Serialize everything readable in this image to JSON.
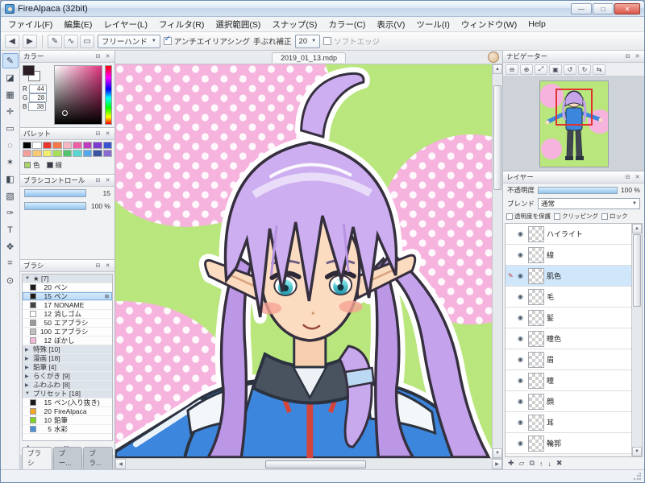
{
  "window": {
    "title": "FireAlpaca (32bit)"
  },
  "window_controls": {
    "minimize": "—",
    "maximize": "□",
    "close": "✕"
  },
  "menu": {
    "items": [
      "ファイル(F)",
      "編集(E)",
      "レイヤー(L)",
      "フィルタ(R)",
      "選択範囲(S)",
      "スナップ(S)",
      "カラー(C)",
      "表示(V)",
      "ツール(I)",
      "ウィンドウ(W)",
      "Help"
    ]
  },
  "toolbar": {
    "back": "◀",
    "forward": "▶",
    "mode_icons": [
      {
        "name": "freehand-stroke-icon",
        "glyph": "✎"
      },
      {
        "name": "curve-stroke-icon",
        "glyph": "∿"
      },
      {
        "name": "rect-stroke-icon",
        "glyph": "▭"
      }
    ],
    "stroke_select": "フリーハンド",
    "antialias_label": "アンチエイリアシング",
    "stabilizer_label": "手ぶれ補正",
    "stabilizer_value": "20",
    "softedge_label": "ソフトエッジ"
  },
  "tools": [
    {
      "name": "brush-tool",
      "glyph": "✎",
      "selected": true
    },
    {
      "name": "eraser-tool",
      "glyph": "◪"
    },
    {
      "name": "dot-tool",
      "glyph": "▦"
    },
    {
      "name": "move-tool",
      "glyph": "✛"
    },
    {
      "name": "select-rect-tool",
      "glyph": "▭"
    },
    {
      "name": "lasso-tool",
      "glyph": "◌"
    },
    {
      "name": "magic-wand-tool",
      "glyph": "✶"
    },
    {
      "name": "bucket-tool",
      "glyph": "◧"
    },
    {
      "name": "gradient-tool",
      "glyph": "▧"
    },
    {
      "name": "eyedropper-tool",
      "glyph": "✑"
    },
    {
      "name": "text-tool",
      "glyph": "T"
    },
    {
      "name": "hand-tool",
      "glyph": "✥"
    },
    {
      "name": "divide-tool",
      "glyph": "⌗"
    },
    {
      "name": "snap-tool",
      "glyph": "⊙"
    }
  ],
  "color_panel": {
    "title": "カラー",
    "channels": [
      {
        "label": "R",
        "value": "44"
      },
      {
        "label": "G",
        "value": "28"
      },
      {
        "label": "B",
        "value": "38"
      }
    ]
  },
  "palette_panel": {
    "title": "パレット",
    "swatches": [
      "#000000",
      "#ffffff",
      "#e8352e",
      "#f2784b",
      "#f7b6c2",
      "#ee5fa7",
      "#c13bbf",
      "#7e3bd0",
      "#3b55d0",
      "#f4a09a",
      "#f7c873",
      "#f3ef6d",
      "#a6e05a",
      "#4fc46a",
      "#58d7d2",
      "#55a7ec",
      "#3b55a0",
      "#8a6ad0"
    ],
    "items": [
      {
        "label": "色",
        "chip": "#a6d36a"
      },
      {
        "label": "線",
        "chip": "#3a3a4a"
      }
    ]
  },
  "brush_control_panel": {
    "title": "ブラシコントロール",
    "size_value": "15",
    "opacity_value": "100 %"
  },
  "brush_panel": {
    "title": "ブラシ",
    "rows": [
      {
        "type": "group",
        "arrow": "▼",
        "label": "★ [7]"
      },
      {
        "size": "20",
        "label": "ペン",
        "swatch": "#1a1a1a"
      },
      {
        "size": "15",
        "label": "ペン",
        "swatch": "#1a1a1a",
        "selected": true
      },
      {
        "size": "17",
        "label": "NONAME",
        "swatch": "#444444"
      },
      {
        "size": "12",
        "label": "消しゴム",
        "swatch": "#ffffff"
      },
      {
        "size": "50",
        "label": "エアブラシ",
        "swatch": "#9a9a9a"
      },
      {
        "size": "100",
        "label": "エアブラシ",
        "swatch": "#c0c0c0"
      },
      {
        "size": "12",
        "label": "ぼかし",
        "swatch": "#f2b8d8"
      },
      {
        "type": "group",
        "arrow": "▶",
        "label": "特殊 [10]"
      },
      {
        "type": "group",
        "arrow": "▶",
        "label": "漫画 [18]"
      },
      {
        "type": "group",
        "arrow": "▶",
        "label": "鉛筆 [4]"
      },
      {
        "type": "group",
        "arrow": "▶",
        "label": "らくがき [9]"
      },
      {
        "type": "group",
        "arrow": "▶",
        "label": "ふわふわ [8]"
      },
      {
        "type": "group",
        "arrow": "▼",
        "label": "プリセット [18]"
      },
      {
        "size": "15",
        "label": "ペン(入り抜き)",
        "swatch": "#1a1a1a"
      },
      {
        "size": "20",
        "label": "FireAlpaca",
        "swatch": "#f5a623"
      },
      {
        "size": "10",
        "label": "鉛筆",
        "swatch": "#7ed321"
      },
      {
        "size": "5",
        "label": "水彩",
        "swatch": "#4a90d9"
      }
    ],
    "footer_icons": [
      {
        "name": "add-brush-icon",
        "glyph": "✚"
      },
      {
        "name": "brush-folder-icon",
        "glyph": "▱"
      },
      {
        "name": "brush-up-icon",
        "glyph": "↑"
      },
      {
        "name": "brush-down-icon",
        "glyph": "↓"
      },
      {
        "name": "delete-brush-icon",
        "glyph": "✖"
      }
    ]
  },
  "dock_tabs": [
    {
      "label": "ブラシ",
      "active": true
    },
    {
      "label": "ブー..."
    },
    {
      "label": "ブラ..."
    }
  ],
  "canvas": {
    "tab": "2019_01_13.mdp"
  },
  "navigator_panel": {
    "title": "ナビゲーター",
    "zoom_icons": [
      {
        "name": "zoom-out-icon",
        "glyph": "⊖"
      },
      {
        "name": "zoom-in-icon",
        "glyph": "⊕"
      },
      {
        "name": "fit-window-icon",
        "glyph": "⤢"
      },
      {
        "name": "actual-size-icon",
        "glyph": "▣"
      },
      {
        "name": "rotate-left-icon",
        "glyph": "↺"
      },
      {
        "name": "rotate-right-icon",
        "glyph": "↻"
      },
      {
        "name": "reset-view-icon",
        "glyph": "⇆"
      }
    ]
  },
  "layer_panel": {
    "title": "レイヤー",
    "opacity_label": "不透明度",
    "opacity_value": "100 %",
    "blend_label": "ブレンド",
    "blend_value": "通常",
    "checkboxes": [
      {
        "label": "透明度を保護"
      },
      {
        "label": "クリッピング"
      },
      {
        "label": "ロック"
      }
    ],
    "layers": [
      {
        "name": "ハイライト"
      },
      {
        "name": "線"
      },
      {
        "name": "肌色",
        "selected": true
      },
      {
        "name": "毛"
      },
      {
        "name": "髪"
      },
      {
        "name": "瞳色"
      },
      {
        "name": "眉"
      },
      {
        "name": "瞳"
      },
      {
        "name": "顔"
      },
      {
        "name": "耳"
      },
      {
        "name": "輪郭"
      }
    ],
    "footer_icons": [
      {
        "name": "new-layer-icon",
        "glyph": "✚"
      },
      {
        "name": "new-folder-icon",
        "glyph": "▱"
      },
      {
        "name": "duplicate-layer-icon",
        "glyph": "⧉"
      },
      {
        "name": "layer-up-icon",
        "glyph": "↑"
      },
      {
        "name": "layer-down-icon",
        "glyph": "↓"
      },
      {
        "name": "delete-layer-icon",
        "glyph": "✖"
      }
    ]
  },
  "icons": {
    "check": "✓",
    "dropdown": "▼",
    "eye": "◉",
    "gear": "✻",
    "pen_mark": "✎",
    "panel_min": "⊟",
    "panel_close": "✕",
    "scroll_up": "▲",
    "scroll_down": "▼",
    "scroll_left": "◀",
    "scroll_right": "▶"
  },
  "colors": {
    "accent_blue": "#3d86dd",
    "selection": "#cfe6fb",
    "hair": "#cdaef0",
    "bg_green": "#b9e77d",
    "dot_pink": "#f5b3dd"
  }
}
